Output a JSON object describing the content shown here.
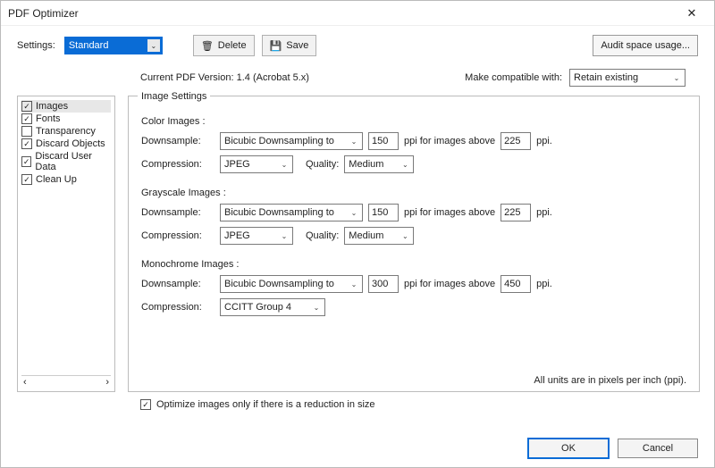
{
  "window": {
    "title": "PDF Optimizer",
    "close": "✕"
  },
  "toolbar": {
    "settings_label": "Settings:",
    "settings_value": "Standard",
    "delete_label": "Delete",
    "save_label": "Save",
    "audit_label": "Audit space usage..."
  },
  "meta": {
    "current_version_label": "Current PDF Version: 1.4 (Acrobat 5.x)",
    "compat_label": "Make compatible with:",
    "compat_value": "Retain existing"
  },
  "sidebar": {
    "items": [
      {
        "label": "Images",
        "checked": true,
        "selected": true
      },
      {
        "label": "Fonts",
        "checked": true
      },
      {
        "label": "Transparency",
        "checked": false
      },
      {
        "label": "Discard Objects",
        "checked": true
      },
      {
        "label": "Discard User Data",
        "checked": true
      },
      {
        "label": "Clean Up",
        "checked": true
      }
    ]
  },
  "panel": {
    "group_title": "Image Settings",
    "labels": {
      "downsample": "Downsample:",
      "compression": "Compression:",
      "quality": "Quality:",
      "ppi_above": "ppi for images above",
      "ppi": "ppi."
    },
    "color": {
      "title": "Color Images :",
      "downsample_method": "Bicubic Downsampling to",
      "dpi": "150",
      "above": "225",
      "compression": "JPEG",
      "quality": "Medium"
    },
    "gray": {
      "title": "Grayscale Images :",
      "downsample_method": "Bicubic Downsampling to",
      "dpi": "150",
      "above": "225",
      "compression": "JPEG",
      "quality": "Medium"
    },
    "mono": {
      "title": "Monochrome Images :",
      "downsample_method": "Bicubic Downsampling to",
      "dpi": "300",
      "above": "450",
      "compression": "CCITT Group 4"
    },
    "units_note": "All units are in pixels per inch (ppi).",
    "optimize_only": "Optimize images only if there is a reduction in size"
  },
  "footer": {
    "ok": "OK",
    "cancel": "Cancel"
  },
  "glyphs": {
    "check": "✓",
    "caret": "⌄",
    "left": "‹",
    "right": "›",
    "trash": "🗑",
    "save": "💾"
  }
}
